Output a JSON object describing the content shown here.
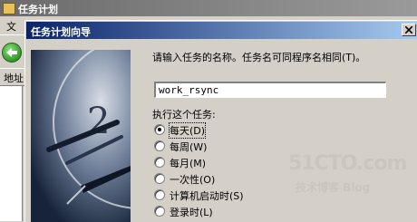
{
  "background_window": {
    "title": "任务计划",
    "menu_first": "文",
    "address_label": "地址"
  },
  "dialog": {
    "title": "任务计划向导",
    "instruction": "请输入任务的名称。任务名可同程序名相同(T)。",
    "task_name_value": "work_rsync",
    "perform_label": "执行这个任务:",
    "options": [
      {
        "label": "每天(D)",
        "checked": true
      },
      {
        "label": "每周(W)",
        "checked": false
      },
      {
        "label": "每月(M)",
        "checked": false
      },
      {
        "label": "一次性(O)",
        "checked": false
      },
      {
        "label": "计算机启动时(S)",
        "checked": false
      },
      {
        "label": "登录时(L)",
        "checked": false
      }
    ]
  },
  "watermark": {
    "site": "51CTO.com",
    "tagline": "技术博客 Blog"
  },
  "icons": {
    "back": "back-arrow-icon",
    "close": "close-icon",
    "app": "scheduled-tasks-icon"
  }
}
